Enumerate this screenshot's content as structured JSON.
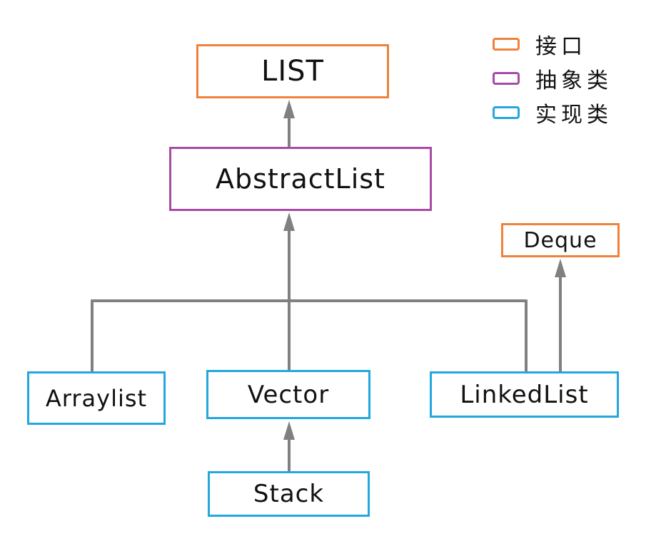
{
  "colors": {
    "interface": "#f0813a",
    "abstract": "#a84ba6",
    "implementation": "#22a7de",
    "edge": "#808080"
  },
  "legend": [
    {
      "label": "接口",
      "kind": "interface"
    },
    {
      "label": "抽象类",
      "kind": "abstract"
    },
    {
      "label": "实现类",
      "kind": "implementation"
    }
  ],
  "nodes": {
    "list": {
      "label": "LIST",
      "kind": "interface"
    },
    "abstract_list": {
      "label": "AbstractList",
      "kind": "abstract"
    },
    "deque": {
      "label": "Deque",
      "kind": "interface"
    },
    "arraylist": {
      "label": "Arraylist",
      "kind": "implementation"
    },
    "vector": {
      "label": "Vector",
      "kind": "implementation"
    },
    "linked_list": {
      "label": "LinkedList",
      "kind": "implementation"
    },
    "stack": {
      "label": "Stack",
      "kind": "implementation"
    }
  },
  "edges": [
    {
      "from": "abstract_list",
      "to": "list"
    },
    {
      "from": "arraylist",
      "to": "abstract_list"
    },
    {
      "from": "vector",
      "to": "abstract_list"
    },
    {
      "from": "linked_list",
      "to": "abstract_list"
    },
    {
      "from": "linked_list",
      "to": "deque"
    },
    {
      "from": "stack",
      "to": "vector"
    }
  ]
}
